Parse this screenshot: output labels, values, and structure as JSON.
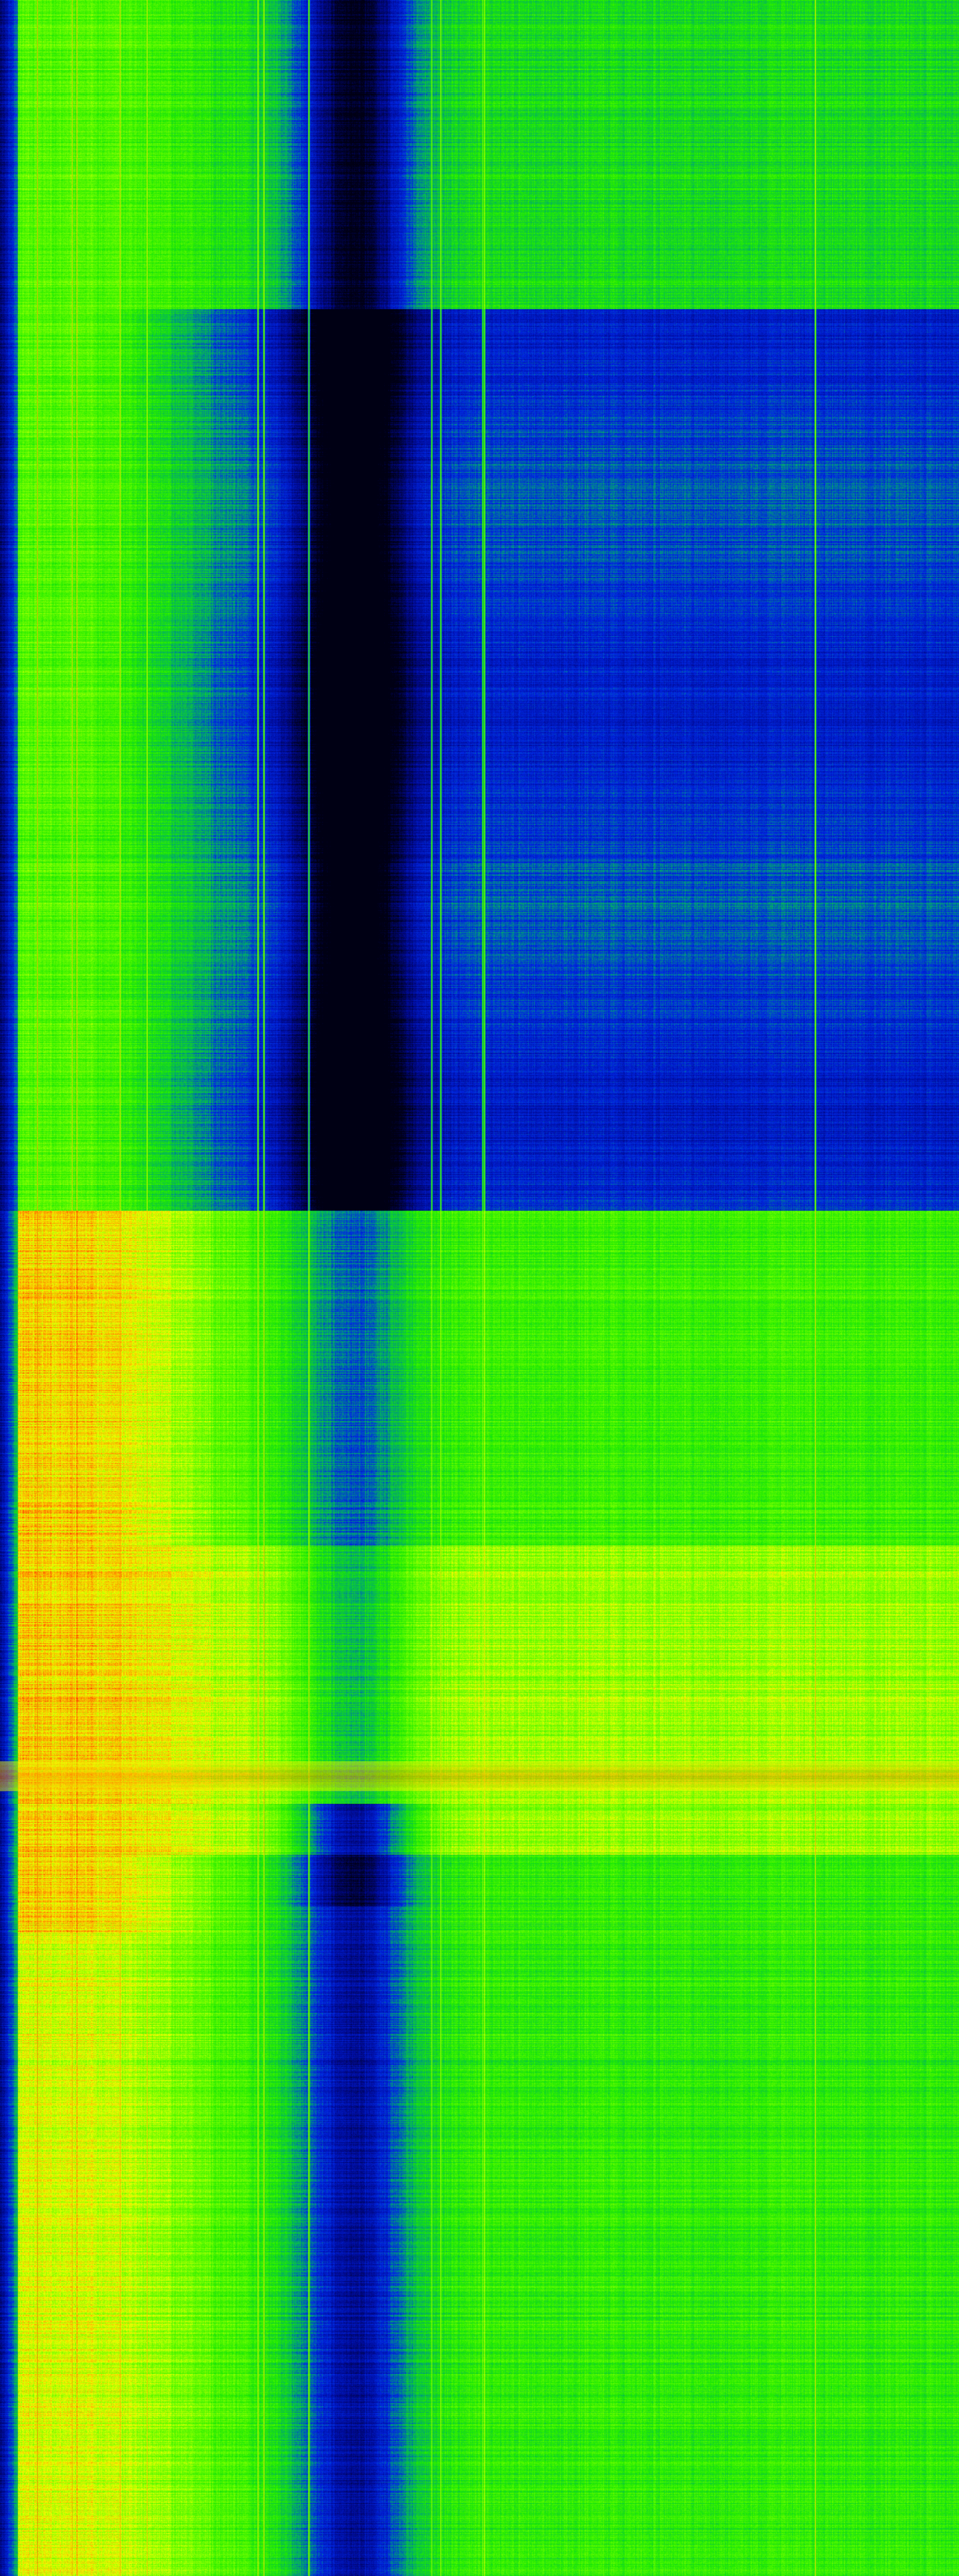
{
  "view": {
    "kind": "spectrogram-waterfall",
    "colormap": "spectrum",
    "colormap_stops": [
      "#00001a",
      "#0010c8",
      "#00aa66",
      "#33ff00",
      "#ffff00",
      "#ff2000"
    ],
    "background_color": "#000000",
    "axes_visible": false,
    "labels_visible": false
  }
}
